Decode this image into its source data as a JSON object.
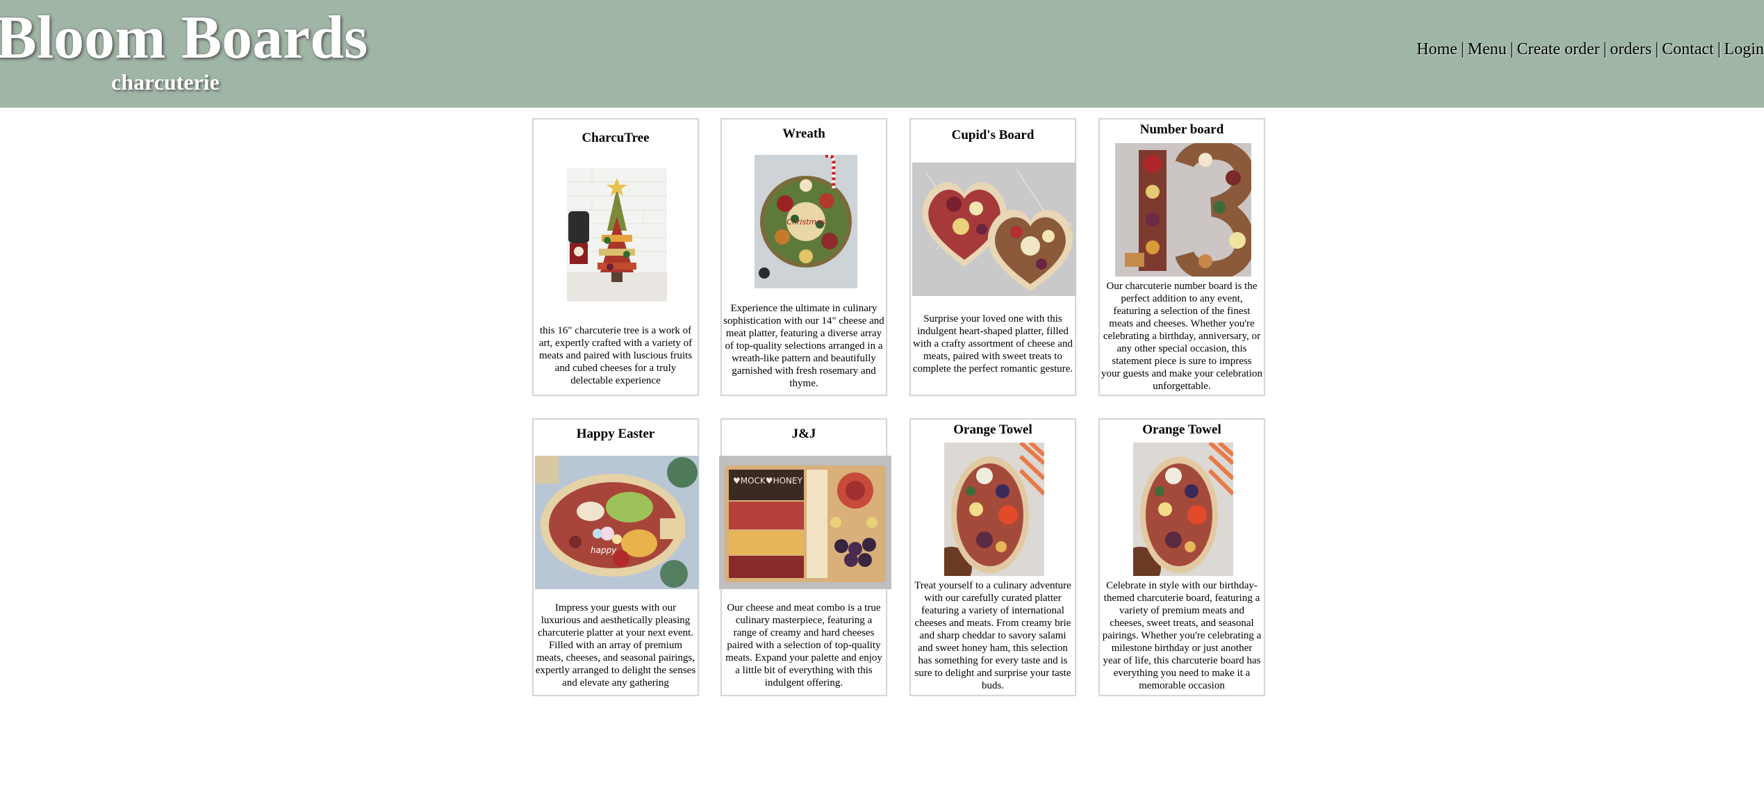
{
  "header": {
    "title": "Bloom Boards",
    "subtitle": "charcuterie",
    "nav": [
      {
        "label": "Home"
      },
      {
        "label": "Menu"
      },
      {
        "label": "Create order"
      },
      {
        "label": "orders"
      },
      {
        "label": "Contact"
      },
      {
        "label": "Login"
      }
    ]
  },
  "products": [
    {
      "title": "CharcuTree",
      "description": "this 16\" charcuterie tree is a work of art, expertly crafted with a variety of meats and paired with luscious fruits and cubed cheeses for a truly delectable experience",
      "image": "charcuterie-tree-photo"
    },
    {
      "title": "Wreath",
      "description": "Experience the ultimate in culinary sophistication with our 14\" cheese and meat platter, featuring a diverse array of top-quality selections arranged in a wreath-like pattern and beautifully garnished with fresh rosemary and thyme.",
      "image": "wreath-board-photo"
    },
    {
      "title": "Cupid's Board",
      "description": "Surprise your loved one with this indulgent heart-shaped platter, filled with a crafty assortment of cheese and meats, paired with sweet treats to complete the perfect romantic gesture.",
      "image": "heart-boards-photo"
    },
    {
      "title": "Number board",
      "description": "Our charcuterie number board is the perfect addition to any event, featuring a selection of the finest meats and cheeses. Whether you're celebrating a birthday, anniversary, or any other special occasion, this statement piece is sure to impress your guests and make your celebration unforgettable.",
      "image": "number-13-board-photo"
    },
    {
      "title": "Happy Easter",
      "description": "Impress your guests with our luxurious and aesthetically pleasing charcuterie platter at your next event. Filled with an array of premium meats, cheeses, and seasonal pairings, expertly arranged to delight the senses and elevate any gathering",
      "image": "easter-board-photo"
    },
    {
      "title": "J&J",
      "description": "Our cheese and meat combo is a true culinary masterpiece, featuring a range of creamy and hard cheeses paired with a selection of top-quality meats. Expand your palette and enjoy a little bit of everything with this indulgent offering.",
      "image": "jj-board-photo"
    },
    {
      "title": "Orange Towel",
      "description": "Treat yourself to a culinary adventure with our carefully curated platter featuring a variety of international cheeses and meats. From creamy brie and sharp cheddar to savory salami and sweet honey ham, this selection has something for every taste and is sure to delight and surprise your taste buds.",
      "image": "orange-towel-board-photo"
    },
    {
      "title": "Orange Towel",
      "description": "Celebrate in style with our birthday-themed charcuterie board, featuring a variety of premium meats and cheeses, sweet treats, and seasonal pairings. Whether you're celebrating a milestone birthday or just another year of life, this charcuterie board has everything you need to make it a memorable occasion",
      "image": "orange-towel-board-photo"
    }
  ],
  "colors": {
    "header_bg": "#9fb5a5",
    "brand_text": "#ffffff",
    "card_border": "#d6d6d6"
  }
}
